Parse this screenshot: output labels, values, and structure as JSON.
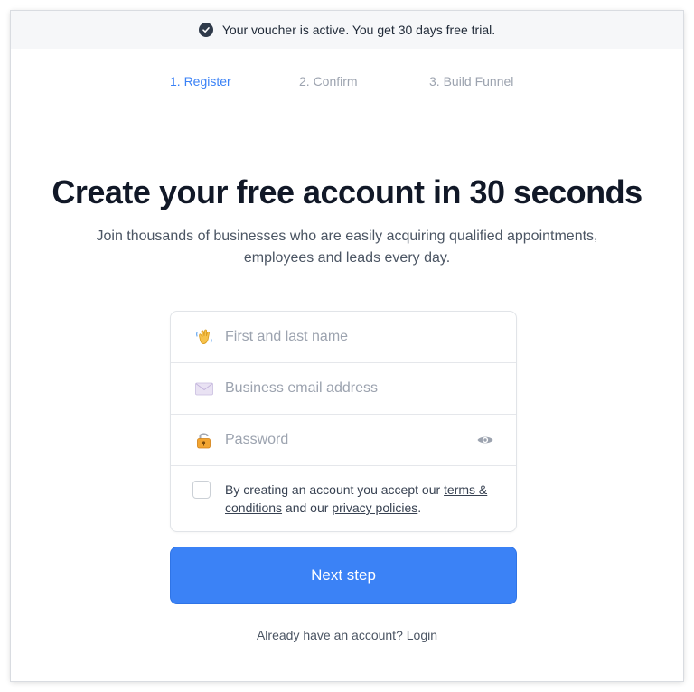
{
  "banner": {
    "icon": "check-circle-icon",
    "text": "Your voucher is active. You get 30 days free trial."
  },
  "steps": [
    {
      "label": "1. Register",
      "state": "active"
    },
    {
      "label": "2. Confirm",
      "state": "inactive"
    },
    {
      "label": "3. Build Funnel",
      "state": "inactive"
    }
  ],
  "headline": "Create your free account in 30 seconds",
  "subtitle": "Join thousands of businesses who are easily acquiring qualified appointments, employees and leads every day.",
  "form": {
    "name": {
      "placeholder": "First and last name",
      "icon": "waving-hand-icon",
      "value": ""
    },
    "email": {
      "placeholder": "Business email address",
      "icon": "envelope-icon",
      "value": ""
    },
    "password": {
      "placeholder": "Password",
      "icon": "lock-icon",
      "toggle_icon": "eye-icon",
      "value": ""
    },
    "terms": {
      "checked": false,
      "prefix": "By creating an account you accept our ",
      "terms_link": "terms & conditions",
      "middle": " and our ",
      "privacy_link": "privacy policies",
      "suffix": "."
    }
  },
  "next_button": "Next step",
  "login": {
    "prompt": "Already have an account? ",
    "link": "Login"
  },
  "colors": {
    "accent": "#3b82f6",
    "banner_bg": "#f6f7f9",
    "inactive_step": "#9ca3af",
    "headline": "#111827"
  }
}
